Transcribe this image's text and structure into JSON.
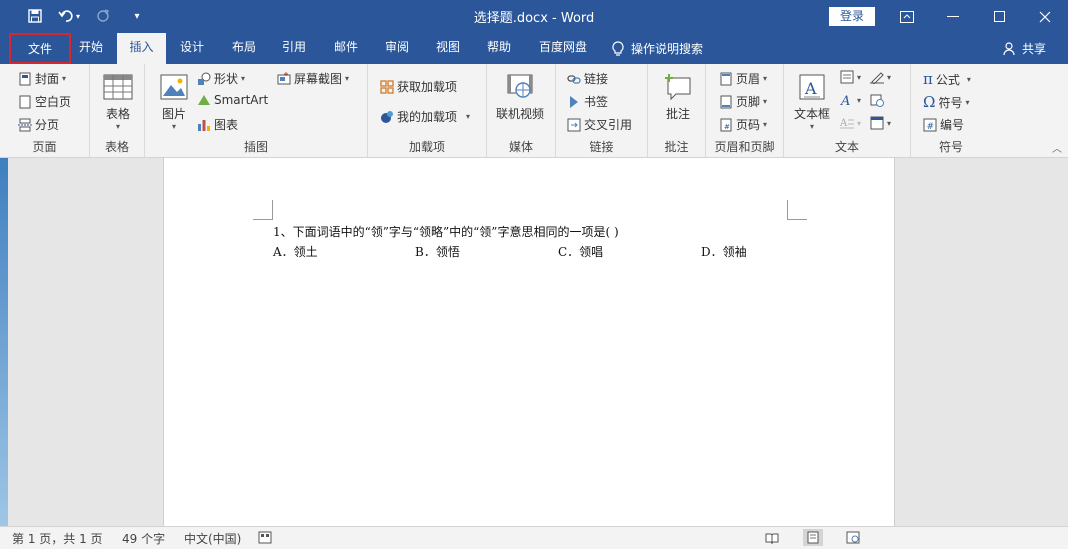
{
  "window": {
    "title": "选择题.docx - Word",
    "login_label": "登录",
    "controls": [
      "restore-ribbon",
      "minimize",
      "maximize",
      "close"
    ]
  },
  "quick_access": {
    "save_icon": "save-icon",
    "undo_icon": "undo-icon",
    "redo_icon": "redo-icon",
    "customize_icon": "customize-qat-icon"
  },
  "tabs": [
    {
      "label": "文件"
    },
    {
      "label": "开始"
    },
    {
      "label": "插入"
    },
    {
      "label": "设计"
    },
    {
      "label": "布局"
    },
    {
      "label": "引用"
    },
    {
      "label": "邮件"
    },
    {
      "label": "审阅"
    },
    {
      "label": "视图"
    },
    {
      "label": "帮助"
    },
    {
      "label": "百度网盘"
    }
  ],
  "active_tab": "插入",
  "tell_me": "操作说明搜索",
  "share": "共享",
  "ribbon": {
    "pages": {
      "label": "页面",
      "cover": "封面",
      "blank": "空白页",
      "break": "分页"
    },
    "tables": {
      "label": "表格",
      "table": "表格"
    },
    "illustrations": {
      "label": "插图",
      "picture": "图片",
      "shapes": "形状",
      "smartart": "SmartArt",
      "chart": "图表",
      "screenshot": "屏幕截图"
    },
    "addins": {
      "label": "加载项",
      "get": "获取加载项",
      "mine": "我的加载项"
    },
    "media": {
      "label": "媒体",
      "online_video": "联机视频"
    },
    "links": {
      "label": "链接",
      "link": "链接",
      "bookmark": "书签",
      "cross_ref": "交叉引用"
    },
    "comments": {
      "label": "批注",
      "comment": "批注"
    },
    "header_footer": {
      "label": "页眉和页脚",
      "header": "页眉",
      "footer": "页脚",
      "page_number": "页码"
    },
    "text": {
      "label": "文本",
      "textbox": "文本框"
    },
    "symbols": {
      "label": "符号",
      "equation": "公式",
      "symbol": "符号",
      "numbering": "编号"
    }
  },
  "document": {
    "question": "1、下面词语中的“领”字与“领略”中的“领”字意思相同的一项是(     )",
    "options": [
      "A．领土",
      "B．领悟",
      "C．领唱",
      "D．领袖"
    ]
  },
  "status": {
    "page": "第 1 页，共 1 页",
    "words": "49 个字",
    "language": "中文(中国)"
  },
  "colors": {
    "accent": "#2b579a",
    "file_highlight": "#d6262e",
    "ribbon_bg": "#f3f3f3"
  }
}
